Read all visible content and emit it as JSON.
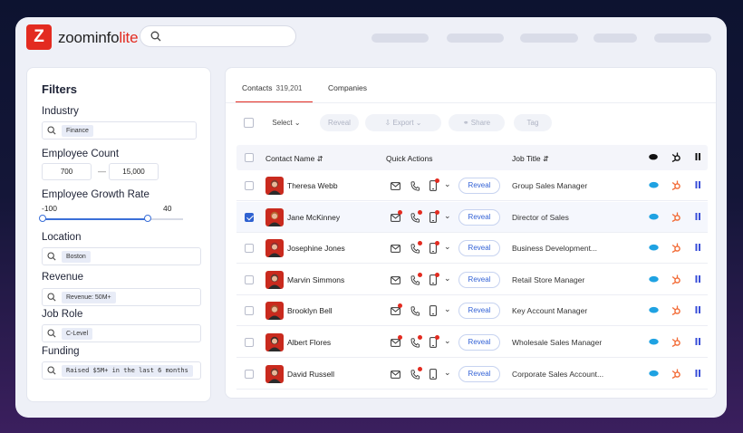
{
  "brand": {
    "name_main": "zoominfo",
    "name_accent": "lite",
    "logo_letter": "Z",
    "accent_color": "#e32b20"
  },
  "filters": {
    "title": "Filters",
    "industry": {
      "label": "Industry",
      "chip": "Finance"
    },
    "employee_count": {
      "label": "Employee Count",
      "min": "700",
      "max": "15,000",
      "separator": "—"
    },
    "employee_growth_rate": {
      "label": "Employee Growth Rate",
      "min": "-100",
      "max": "40",
      "min_fraction": 0.0,
      "max_fraction": 0.75
    },
    "location": {
      "label": "Location",
      "chip": "Boston"
    },
    "revenue": {
      "label": "Revenue",
      "chip": "Revenue: 50M+"
    },
    "job_role": {
      "label": "Job Role",
      "chip": "C-Level"
    },
    "funding": {
      "label": "Funding",
      "chip": "Raised $5M+ in the last 6 months"
    }
  },
  "tabs": {
    "contacts_label": "Contacts",
    "contacts_count": "319,201",
    "companies_label": "Companies"
  },
  "toolbar": {
    "select_label": "Select",
    "reveal_label": "Reveal",
    "export_label": "Export",
    "share_label": "Share",
    "tag_label": "Tag"
  },
  "table": {
    "columns": {
      "contact_name": "Contact Name",
      "quick_actions": "Quick Actions",
      "job_title": "Job Title"
    },
    "reveal_label": "Reveal",
    "rows": [
      {
        "name": "Theresa Webb",
        "title": "Group Sales Manager",
        "selected": false
      },
      {
        "name": "Jane McKinney",
        "title": "Director of Sales",
        "selected": true
      },
      {
        "name": "Josephine Jones",
        "title": "Business Development...",
        "selected": false
      },
      {
        "name": "Marvin Simmons",
        "title": "Retail Store Manager",
        "selected": false
      },
      {
        "name": "Brooklyn Bell",
        "title": "Key Account Manager",
        "selected": false
      },
      {
        "name": "Albert Flores",
        "title": "Wholesale Sales Manager",
        "selected": false
      },
      {
        "name": "David Russell",
        "title": "Corporate Sales Account...",
        "selected": false
      }
    ]
  },
  "icons": {
    "search": "search-icon",
    "email": "email-icon",
    "phone": "phone-icon",
    "mobile": "mobile-icon",
    "salesforce": "salesforce-icon",
    "hubspot": "hubspot-icon",
    "outreach": "outreach-icon"
  }
}
